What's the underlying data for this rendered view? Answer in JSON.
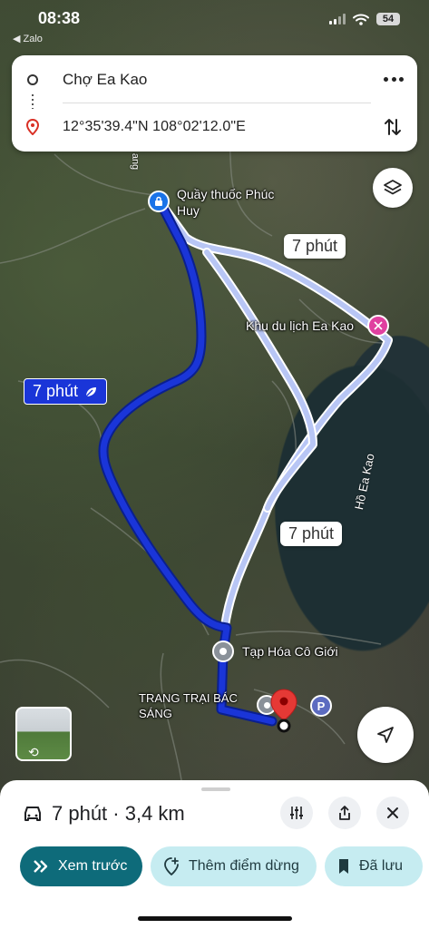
{
  "status_bar": {
    "time": "08:38",
    "back_app": "◀ Zalo",
    "battery": "54"
  },
  "route_card": {
    "origin": "Chợ Ea Kao",
    "destination": "12°35'39.4\"N 108°02'12.0\"E"
  },
  "map": {
    "places": {
      "start_shop": "Quầy thuốc Phúc\nHuy",
      "tourist_area": "Khu du lịch Ea Kao",
      "grocery": "Tạp Hóa Cô Giới",
      "farm": "TRANG TRẠI BÁC\nSÁNG",
      "lake": "Hồ Ea Kao",
      "road_fragment": "ang"
    },
    "routes": {
      "primary_eta": "7 phút",
      "alt_eta_1": "7 phút",
      "alt_eta_2": "7 phút"
    },
    "parking_label": "P",
    "colors": {
      "primary_route": "#1a35d8",
      "alt_route": "#b8c6f5",
      "destination_pin": "#e53935",
      "poi_tourism": "#e040a0"
    }
  },
  "bottom_sheet": {
    "summary": "7 phút · 3,4 km",
    "preview_label": "Xem trước",
    "add_stop_label": "Thêm điểm dừng",
    "saved_label": "Đã lưu"
  }
}
